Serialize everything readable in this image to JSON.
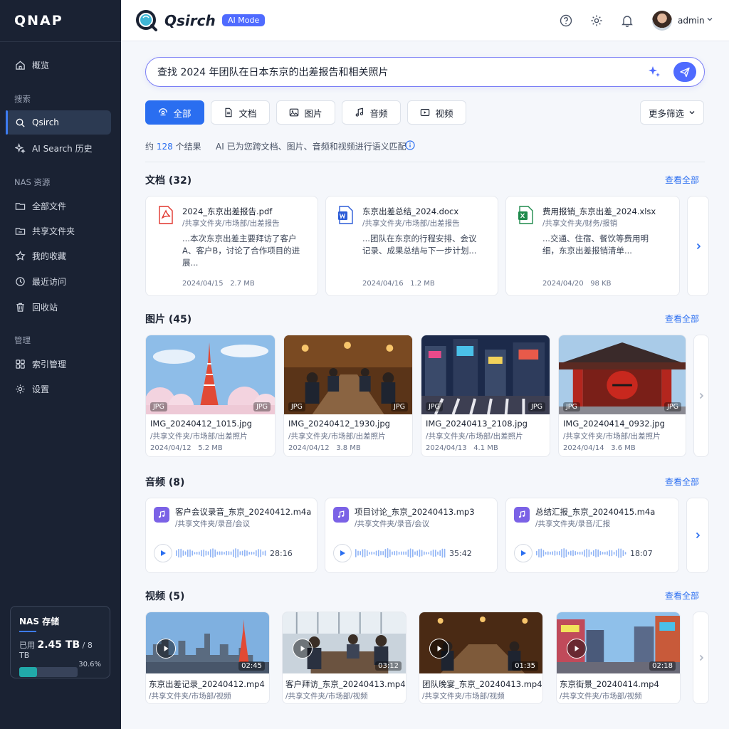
{
  "sidebar": {
    "logo": "QNAP",
    "items": [
      {
        "label": "概览"
      },
      {
        "label": "Qsirch"
      },
      {
        "label": "AI Search 历史"
      },
      {
        "label": "全部文件"
      },
      {
        "label": "共享文件夹"
      },
      {
        "label": "我的收藏"
      },
      {
        "label": "最近访问"
      },
      {
        "label": "回收站"
      },
      {
        "label": "索引管理"
      },
      {
        "label": "设置"
      }
    ],
    "sections": {
      "search": "搜索",
      "nas": "NAS 资源",
      "manage": "管理"
    },
    "storage": {
      "title": "NAS 存储",
      "used_prefix": "已用",
      "used": "2.45 TB",
      "total": "/ 8 TB",
      "percent_label": "30.6%",
      "percent": 30.6
    }
  },
  "header": {
    "app_title": "Qsirch",
    "ai_mode": "AI Mode",
    "username": "admin"
  },
  "search": {
    "query": "查找 2024 年团队在日本东京的出差报告和相关照片"
  },
  "filters": {
    "tabs": [
      {
        "label": "全部"
      },
      {
        "label": "文档"
      },
      {
        "label": "图片"
      },
      {
        "label": "音频"
      },
      {
        "label": "视频"
      }
    ],
    "more": "更多筛选"
  },
  "results": {
    "prefix": "约",
    "count": "128",
    "suffix": "个结果",
    "note": "AI 已为您跨文档、图片、音频和视频进行语义匹配"
  },
  "view_all": "查看全部",
  "documents": {
    "title": "文档 (32)",
    "items": [
      {
        "name": "2024_东京出差报告.pdf",
        "path": "/共享文件夹/市场部/出差报告",
        "snippet": "...本次东京出差主要拜访了客户A、客户B，讨论了合作项目的进展...",
        "date": "2024/04/15",
        "size": "2.7 MB",
        "type": "pdf",
        "color": "#e0342c"
      },
      {
        "name": "东京出差总结_2024.docx",
        "path": "/共享文件夹/市场部/出差报告",
        "snippet": "...团队在东京的行程安排、会议记录、成果总结与下一步计划...",
        "date": "2024/04/16",
        "size": "1.2 MB",
        "type": "docx",
        "color": "#2b5bd7"
      },
      {
        "name": "费用报销_东京出差_2024.xlsx",
        "path": "/共享文件夹/财务/报销",
        "snippet": "...交通、住宿、餐饮等费用明细，东京出差报销清单...",
        "date": "2024/04/20",
        "size": "98 KB",
        "type": "xlsx",
        "color": "#1e8a4c"
      }
    ]
  },
  "images": {
    "title": "图片 (45)",
    "items": [
      {
        "name": "IMG_20240412_1015.jpg",
        "path": "/共享文件夹/市场部/出差照片",
        "date": "2024/04/12",
        "size": "5.2 MB",
        "tag": "JPG"
      },
      {
        "name": "IMG_20240412_1930.jpg",
        "path": "/共享文件夹/市场部/出差照片",
        "date": "2024/04/12",
        "size": "3.8 MB",
        "tag": "JPG"
      },
      {
        "name": "IMG_20240413_2108.jpg",
        "path": "/共享文件夹/市场部/出差照片",
        "date": "2024/04/13",
        "size": "4.1 MB",
        "tag": "JPG"
      },
      {
        "name": "IMG_20240414_0932.jpg",
        "path": "/共享文件夹/市场部/出差照片",
        "date": "2024/04/14",
        "size": "3.6 MB",
        "tag": "JPG"
      }
    ]
  },
  "audio": {
    "title": "音频 (8)",
    "items": [
      {
        "name": "客户会议录音_东京_20240412.m4a",
        "path": "/共享文件夹/录音/会议",
        "duration": "28:16"
      },
      {
        "name": "项目讨论_东京_20240413.mp3",
        "path": "/共享文件夹/录音/会议",
        "duration": "35:42"
      },
      {
        "name": "总结汇报_东京_20240415.m4a",
        "path": "/共享文件夹/录音/汇报",
        "duration": "18:07"
      }
    ]
  },
  "videos": {
    "title": "视频 (5)",
    "items": [
      {
        "name": "东京出差记录_20240412.mp4",
        "path": "/共享文件夹/市场部/视频",
        "duration": "02:45"
      },
      {
        "name": "客户拜访_东京_20240413.mp4",
        "path": "/共享文件夹/市场部/视频",
        "duration": "03:12"
      },
      {
        "name": "团队晚宴_东京_20240413.mp4",
        "path": "/共享文件夹/市场部/视频",
        "duration": "01:35"
      },
      {
        "name": "东京街景_20240414.mp4",
        "path": "/共享文件夹/市场部/视频",
        "duration": "02:18"
      }
    ]
  },
  "colors": {
    "accent": "#2a6ef0",
    "sidebar_bg": "#1a2233",
    "ai_purple": "#4f6bff"
  }
}
